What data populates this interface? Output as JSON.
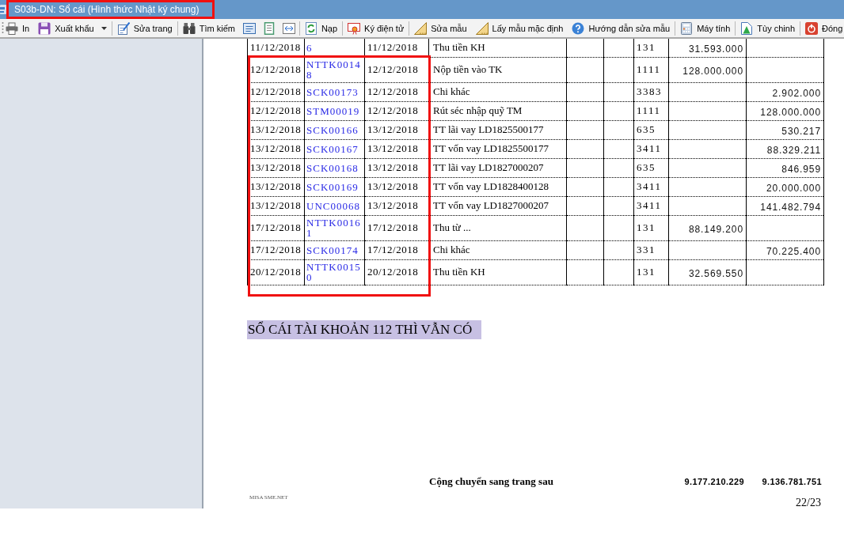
{
  "window": {
    "title": "S03b-DN: Sổ cái (Hình thức Nhật ký chung)",
    "title_framed": true
  },
  "toolbar": {
    "groups": [
      [
        {
          "kind": "labeled",
          "label": "In",
          "dropdown": false
        },
        {
          "kind": "labeled",
          "label": "Xuất khẩu",
          "dropdown": true
        }
      ],
      [
        {
          "kind": "labeled",
          "label": "Sửa trang",
          "dropdown": false
        }
      ],
      [
        {
          "kind": "labeled",
          "label": "Tìm kiếm",
          "dropdown": false
        },
        {
          "kind": "icon_only",
          "dropdown": false
        },
        {
          "kind": "icon_only",
          "dropdown": false
        },
        {
          "kind": "icon_only",
          "dropdown": false
        }
      ],
      [
        {
          "kind": "labeled",
          "label": "Nạp",
          "dropdown": false
        }
      ],
      [
        {
          "kind": "labeled",
          "label": "Ký điện tử",
          "dropdown": false
        }
      ],
      [
        {
          "kind": "labeled",
          "label": "Sửa mẫu",
          "dropdown": false
        },
        {
          "kind": "labeled",
          "label": "Lấy mẫu mặc định",
          "dropdown": false
        },
        {
          "kind": "labeled",
          "label": "Hướng dẫn sửa mẫu",
          "dropdown": false
        }
      ],
      [
        {
          "kind": "labeled",
          "label": "Máy tính",
          "dropdown": false
        }
      ],
      [
        {
          "kind": "labeled",
          "label": "Tùy chinh",
          "dropdown": false
        }
      ],
      [
        {
          "kind": "labeled",
          "label": "Đóng",
          "dropdown": false
        }
      ]
    ]
  },
  "ledger": {
    "sections": [
      {
        "framed": false,
        "rows": [
          {
            "date": "11/12/2018",
            "voucher_no": "6",
            "voucher_date": "11/12/2018",
            "description": "Thu tiền KH",
            "account": "131",
            "debit": "31.593.000"
          }
        ]
      },
      {
        "framed": true,
        "rows": [
          {
            "date": "12/12/2018",
            "voucher_no": "NTTK00148",
            "voucher_date": "12/12/2018",
            "description": "Nộp tiền vào TK",
            "account": "1111",
            "debit": "128.000.000"
          },
          {
            "date": "12/12/2018",
            "voucher_no": "SCK00173",
            "voucher_date": "12/12/2018",
            "description": "Chi khác",
            "account": "3383",
            "credit": "2.902.000"
          },
          {
            "date": "12/12/2018",
            "voucher_no": "STM00019",
            "voucher_date": "12/12/2018",
            "description": "Rút séc nhập quỹ TM",
            "account": "1111",
            "credit": "128.000.000"
          },
          {
            "date": "13/12/2018",
            "voucher_no": "SCK00166",
            "voucher_date": "13/12/2018",
            "description": "TT lãi vay LD1825500177",
            "account": "635",
            "credit": "530.217"
          },
          {
            "date": "13/12/2018",
            "voucher_no": "SCK00167",
            "voucher_date": "13/12/2018",
            "description": "TT vốn vay LD1825500177",
            "account": "3411",
            "credit": "88.329.211"
          },
          {
            "date": "13/12/2018",
            "voucher_no": "SCK00168",
            "voucher_date": "13/12/2018",
            "description": "TT lãi vay LD1827000207",
            "account": "635",
            "credit": "846.959"
          },
          {
            "date": "13/12/2018",
            "voucher_no": "SCK00169",
            "voucher_date": "13/12/2018",
            "description": "TT vốn vay LD1828400128",
            "account": "3411",
            "credit": "20.000.000"
          },
          {
            "date": "13/12/2018",
            "voucher_no": "UNC00068",
            "voucher_date": "13/12/2018",
            "description": "TT vốn vay LD1827000207",
            "account": "3411",
            "credit": "141.482.794"
          },
          {
            "date": "17/12/2018",
            "voucher_no": "NTTK00161",
            "voucher_date": "17/12/2018",
            "description": "Thu từ ...",
            "account": "131",
            "debit": "88.149.200"
          },
          {
            "date": "17/12/2018",
            "voucher_no": "SCK00174",
            "voucher_date": "17/12/2018",
            "description": "Chi khác",
            "account": "331",
            "credit": "70.225.400"
          },
          {
            "date": "20/12/2018",
            "voucher_no": "NTTK00150",
            "voucher_date": "20/12/2018",
            "description": "Thu tiền KH",
            "account": "131",
            "debit": "32.569.550"
          }
        ]
      }
    ]
  },
  "note": "SỔ CÁI TÀI KHOẢN 112 THÌ VẪN CÓ",
  "footer": {
    "carry_forward_label": "Cộng chuyển sang trang sau",
    "debit_total": "9.177.210.229",
    "credit_total": "9.136.781.751",
    "software": "MISA SME.NET",
    "page_number": "22/23"
  }
}
